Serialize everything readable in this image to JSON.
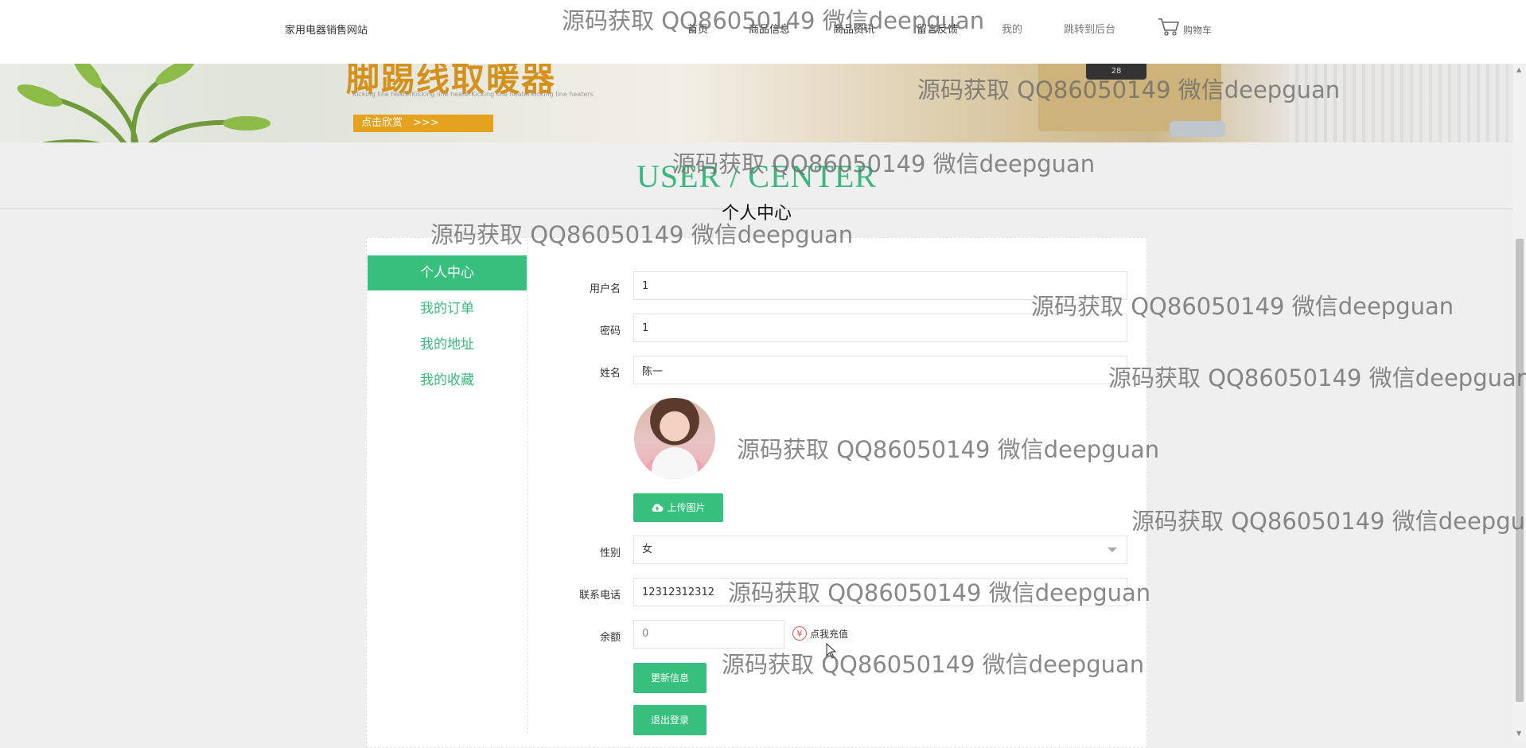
{
  "header": {
    "site_title": "家用电器销售网站",
    "nav": [
      "首页",
      "商品信息",
      "商品资讯",
      "留言反馈",
      "我的",
      "跳转到后台"
    ],
    "cart_label": "购物车"
  },
  "banner": {
    "title": "脚踢线取暖器",
    "subtitle": "Kicking line heaterKicking line heaterKicking line heaterKicking line heaters",
    "button_label": "点击欣赏　>>>",
    "display": "28"
  },
  "section": {
    "title_en": "USER / CENTER",
    "title_cn": "个人中心"
  },
  "sidebar": {
    "items": [
      {
        "label": "个人中心",
        "active": true
      },
      {
        "label": "我的订单",
        "active": false
      },
      {
        "label": "我的地址",
        "active": false
      },
      {
        "label": "我的收藏",
        "active": false
      }
    ]
  },
  "form": {
    "username": {
      "label": "用户名",
      "value": "1"
    },
    "password": {
      "label": "密码",
      "value": "1"
    },
    "name": {
      "label": "姓名",
      "value": "陈一"
    },
    "upload_label": "上传图片",
    "gender": {
      "label": "性别",
      "value": "女"
    },
    "phone": {
      "label": "联系电话",
      "value": "12312312312"
    },
    "balance": {
      "label": "余额",
      "value": "0"
    },
    "recharge_label": "点我充值",
    "update_label": "更新信息",
    "logout_label": "退出登录"
  },
  "watermark": "源码获取 QQ86050149 微信deepguan",
  "colors": {
    "accent": "#36bf7d",
    "banner_title": "#d4911c"
  }
}
